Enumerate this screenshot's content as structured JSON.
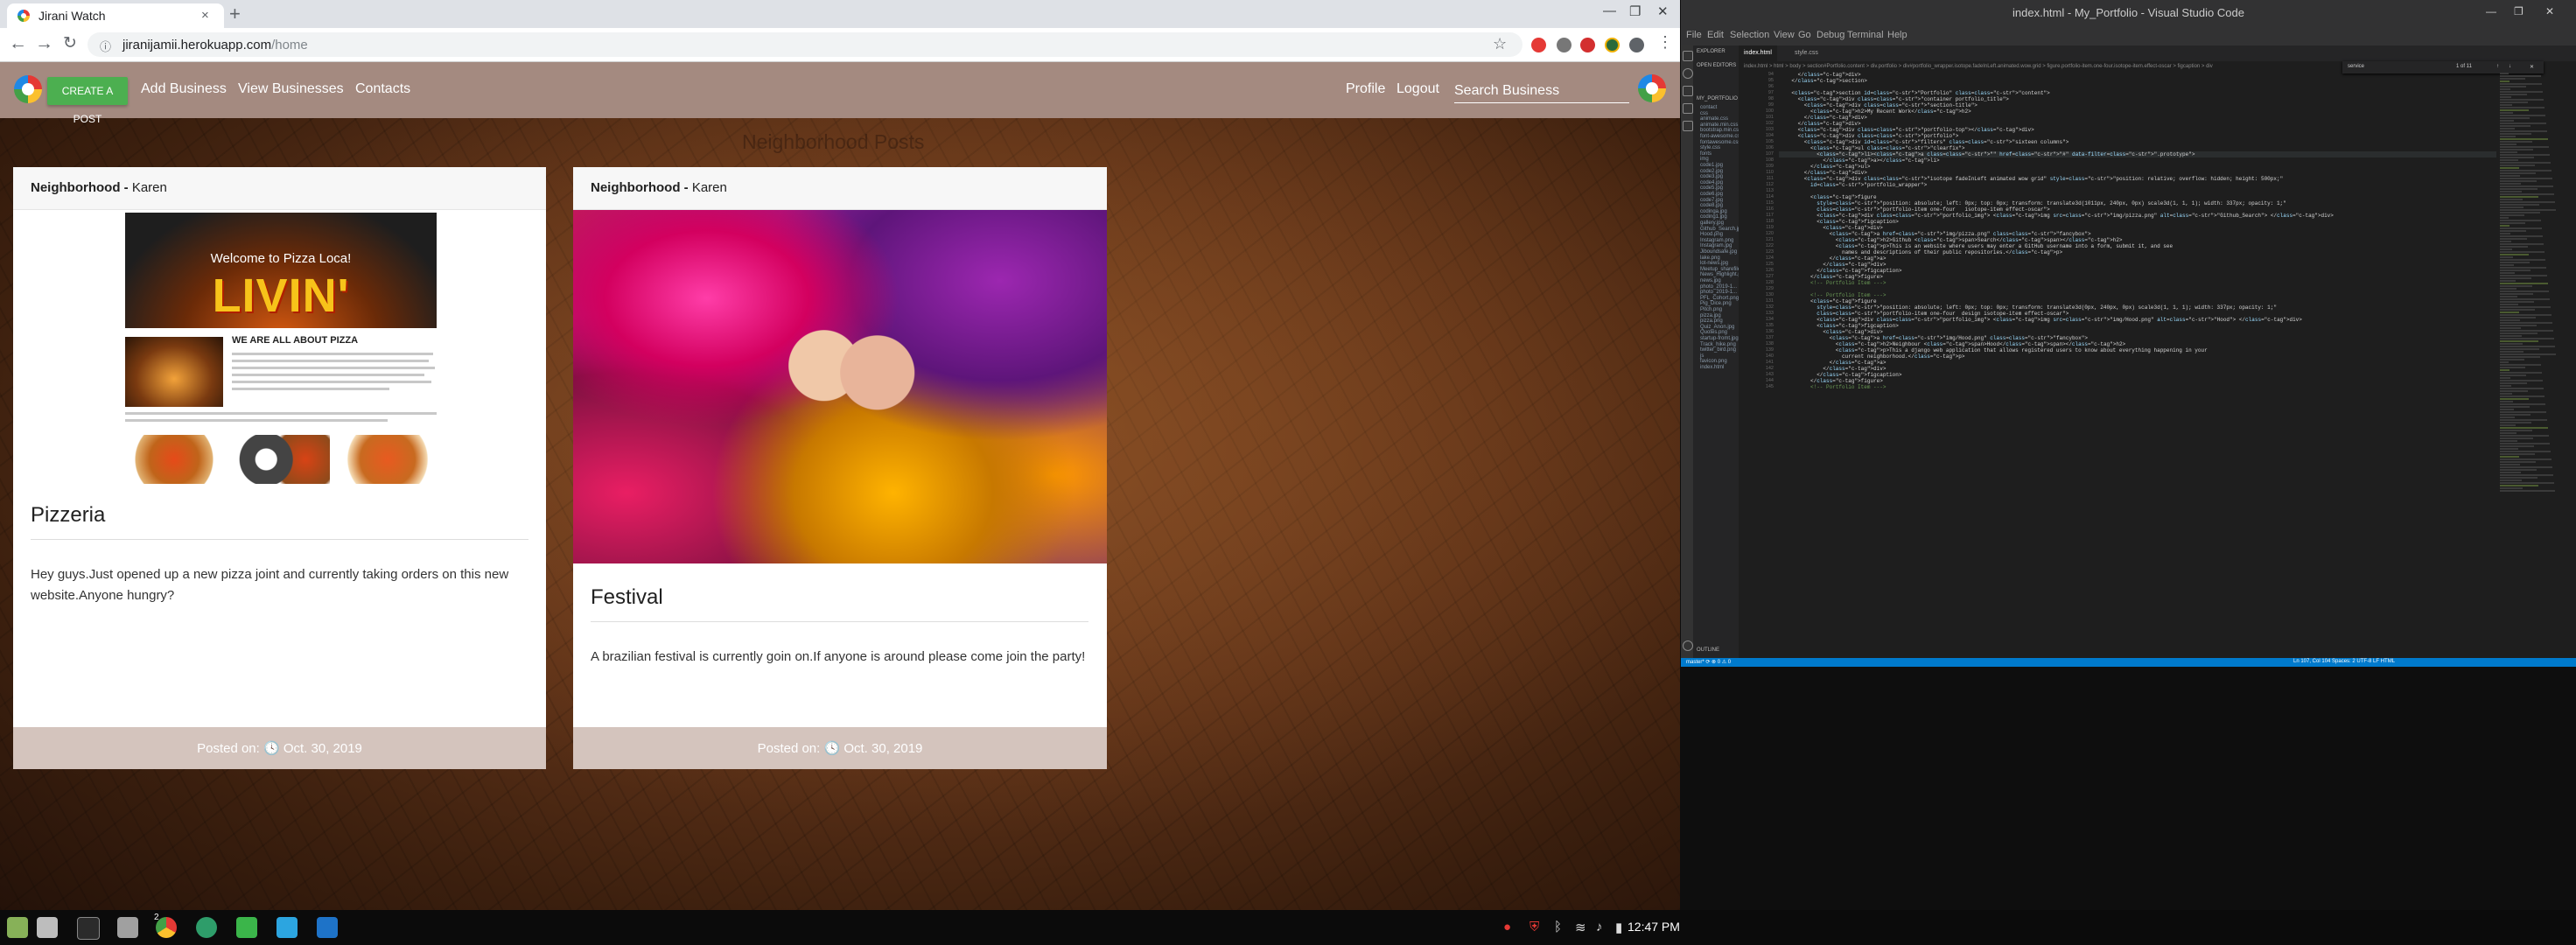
{
  "browser": {
    "tab_title": "Jirani Watch",
    "url_host": "jiranijamii.herokuapp.com",
    "url_path": "/home",
    "window_min": "—",
    "window_max": "❐",
    "window_close": "✕",
    "new_tab": "+",
    "tab_close": "×"
  },
  "site": {
    "create_post": "CREATE A POST",
    "nav_left": [
      "Add Business",
      "View Businesses",
      "Contacts"
    ],
    "nav_right": [
      "Profile",
      "Logout"
    ],
    "search_placeholder": "Search Business",
    "page_heading": "Neighborhood Posts",
    "posts": [
      {
        "header_bold": "Neighborhood -",
        "header_name": " Karen",
        "title": "Pizzeria",
        "body": "Hey guys.Just opened up a new pizza joint and currently taking orders on this new website.Anyone hungry?",
        "footer_label": "Posted on:",
        "footer_date": "Oct. 30, 2019",
        "image_welcome": "Welcome to Pizza Loca!",
        "image_livin": "LIVIN'",
        "image_about": "WE ARE ALL ABOUT PIZZA"
      },
      {
        "header_bold": "Neighborhood -",
        "header_name": " Karen",
        "title": "Festival",
        "body": "A brazilian festival is currently goin on.If anyone is around please come join the party!",
        "footer_label": "Posted on:",
        "footer_date": "Oct. 30, 2019"
      }
    ]
  },
  "vscode": {
    "title": "index.html - My_Portfolio - Visual Studio Code",
    "menu": [
      "File",
      "Edit",
      "Selection",
      "View",
      "Go",
      "Debug",
      "Terminal",
      "Help"
    ],
    "explorer_header": "EXPLORER",
    "open_editors": "OPEN EDITORS",
    "project": "MY_PORTFOLIO",
    "files": [
      "contact",
      "css",
      "animate.css",
      "animate.min.css",
      "bootstrap.min.css",
      "font-awesome.css",
      "fontawesome.css",
      "style.css",
      "fonts",
      "img",
      "code1.jpg",
      "code2.jpg",
      "code3.jpg",
      "code4.jpg",
      "code5.jpg",
      "code6.jpg",
      "code7.jpg",
      "code8.jpg",
      "codinga.jpg",
      "coding1.jpg",
      "gallery.jpg",
      "Github_Search.jpg",
      "Hood.png",
      "Instagram.png",
      "Instagram.jpg",
      "Jiboundsafe.jpg",
      "lake.png",
      "lot-news.jpg",
      "Meetup_sharefile...",
      "News_Highlight.png",
      "news.jpg",
      "photo_2019-1...",
      "photo_2019-1...",
      "PFL_Cohort.png",
      "Pig_Dice.png",
      "Pitch.png",
      "pizza.jpg",
      "pizza.png",
      "Quiz_Anon.jpg",
      "Quotes.png",
      "startup-fromt.jpg",
      "Track_hike.png",
      "twitter_bird.png",
      "js",
      "favicon.png",
      "index.html"
    ],
    "outline": "OUTLINE",
    "tabs": [
      "index.html",
      "style.css"
    ],
    "breadcrumb": "index.html > html > body > section#Portfolio.content > div.portfolio > div#portfolio_wrapper.isotope.fadeInLeft.animated.wow.grid > figure.portfolio-item.one-four.isotope-item.effect-oscar > figcaption > div",
    "find_query": "service",
    "find_count": "1 of 11",
    "line_numbers": [
      "94",
      "95",
      "96",
      "97",
      "98",
      "99",
      "100",
      "101",
      "102",
      "103",
      "104",
      "105",
      "106",
      "107",
      "108",
      "109",
      "110",
      "111",
      "112",
      "113",
      "114",
      "115",
      "116",
      "117",
      "118",
      "119",
      "120",
      "121",
      "122",
      "123",
      "124",
      "125",
      "126",
      "127",
      "128",
      "129",
      "130",
      "131",
      "132",
      "133",
      "134",
      "135",
      "136",
      "137",
      "138",
      "139",
      "140",
      "141",
      "142",
      "143",
      "144",
      "145"
    ],
    "code_lines": [
      "      </div>",
      "    </section>",
      "",
      "    <section id=\"Portfolio\" class=\"content\">",
      "      <div class=\"container portfolio_title\">",
      "        <div class=\"section-title\">",
      "          <h2>My Recent Work</h2>",
      "        </div>",
      "      </div>",
      "      <div class=\"portfolio-top\"></div>",
      "      <div class=\"portfolio\">",
      "        <div id=\"filters\" class=\"sixteen columns\">",
      "          <ul class=\"clearfix\">",
      "            <li><a class=\"\" href=\"#\" data-filter=\".prototype\">",
      "              </a></li>",
      "          </ul>",
      "        </div>",
      "        <div class=\"isotope fadeInLeft animated wow grid\" style=\"position: relative; overflow: hidden; height: 500px;\"",
      "          id=\"portfolio_wrapper\">",
      "",
      "          <figure",
      "            style=\"position: absolute; left: 0px; top: 0px; transform: translate3d(1011px, 240px, 0px) scale3d(1, 1, 1); width: 337px; opacity: 1;\"",
      "            class=\"portfolio-item one-four   isotope-item effect-oscar\">",
      "            <div class=\"portfolio_img\"> <img src=\"img/pizza.png\" alt=\"Github_Search\"> </div>",
      "            <figcaption>",
      "              <div>",
      "                <a href=\"img/pizza.png\" class=\"fancybox\">",
      "                  <h2>Github <span>Search</span></h2>",
      "                  <p>This is an website where users may enter a GitHub username into a form, submit it, and see",
      "                    names and descriptions of their public repositories.</p>",
      "                </a>",
      "              </div>",
      "            </figcaption>",
      "          </figure>",
      "          <!-- Portfolio Item --->",
      "",
      "          <!-- Portfolio Item --->",
      "          <figure",
      "            style=\"position: absolute; left: 0px; top: 0px; transform: translate3d(0px, 240px, 0px) scale3d(1, 1, 1); width: 337px; opacity: 1;\"",
      "            class=\"portfolio-item one-four  design isotope-item effect-oscar\">",
      "            <div class=\"portfolio_img\"> <img src=\"img/Hood.png\" alt=\"Hood\"> </div>",
      "            <figcaption>",
      "              <div>",
      "                <a href=\"img/Hood.png\" class=\"fancybox\">",
      "                  <h2>Neighbour <span>Hood</span></h2>",
      "                  <p>This a django web application that allows registered users to know about everything happening in your",
      "                    current neighborhood.</p>",
      "                </a>",
      "              </div>",
      "            </figcaption>",
      "          </figure>",
      "          <!-- Portfolio Item --->"
    ],
    "status_left": "master* ⟳ ⊗ 0 ⚠ 0",
    "status_right": "Ln 107, Col 104   Spaces: 2   UTF-8   LF   HTML"
  },
  "taskbar": {
    "clock": "12:47 PM",
    "badge": "2"
  }
}
